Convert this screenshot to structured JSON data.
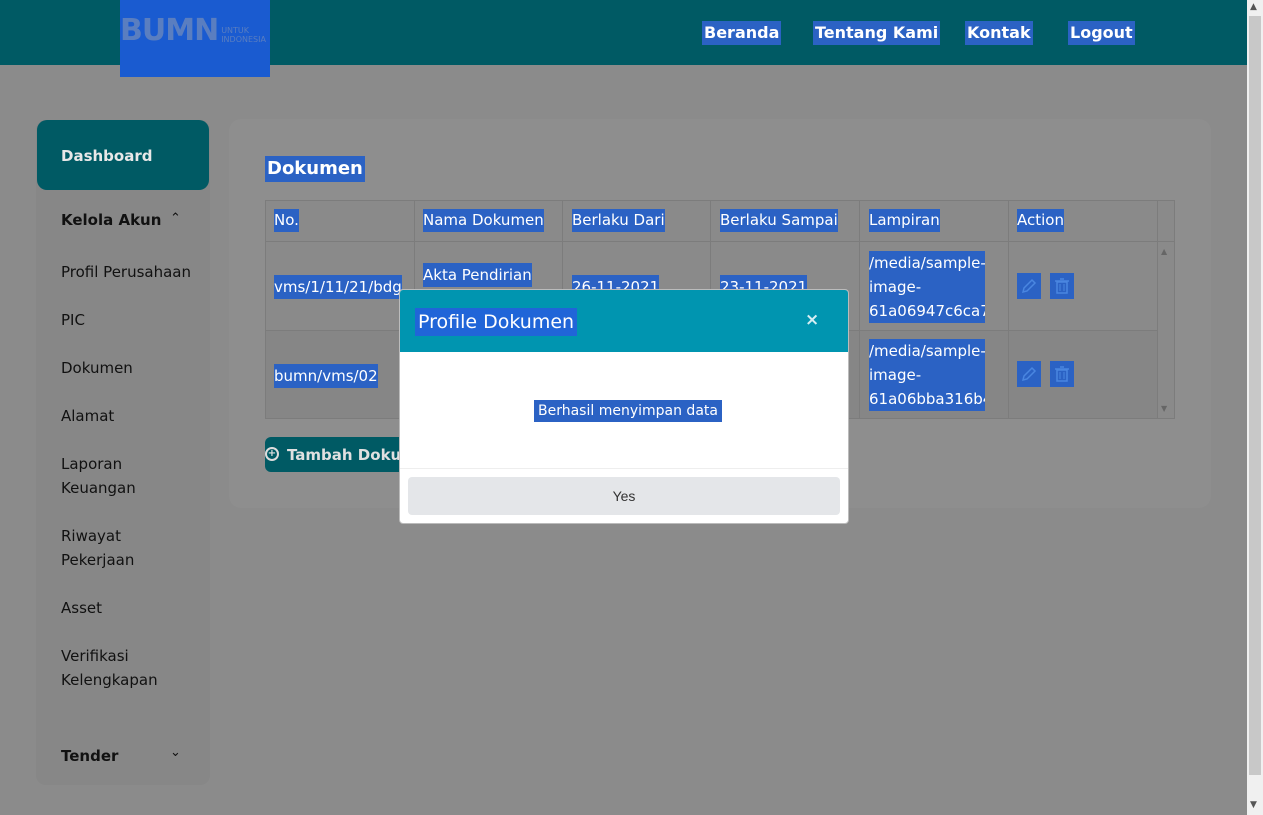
{
  "header": {
    "logo_text": "BUMN",
    "logo_subtext": "UNTUK INDONESIA",
    "nav": [
      "Beranda",
      "Tentang Kami",
      "Kontak",
      "Logout"
    ]
  },
  "sidebar": {
    "dashboard": "Dashboard",
    "kelola_akun": "Kelola Akun",
    "items": [
      "Profil Perusahaan",
      "PIC",
      "Dokumen",
      "Alamat",
      "Laporan Keuangan",
      "Riwayat Pekerjaan",
      "Asset",
      "Verifikasi Kelengkapan"
    ],
    "tender": "Tender"
  },
  "main": {
    "title": "Dokumen",
    "columns": [
      "No.",
      "Nama Dokumen",
      "Berlaku Dari",
      "Berlaku Sampai",
      "Lampiran",
      "Action"
    ],
    "rows": [
      {
        "no": "vms/1/11/21/bdg",
        "nama": "Akta Pendirian",
        "dari": "26-11-2021",
        "sampai": "23-11-2021",
        "lampiran": "/media/sample-image-61a06947c6ca70..."
      },
      {
        "no": "bumn/vms/02",
        "nama": "",
        "dari": "",
        "sampai": "",
        "lampiran": "/media/sample-image-61a06bba316b4..."
      }
    ],
    "add_button": "Tambah Dokumen"
  },
  "modal": {
    "title": "Profile Dokumen",
    "close": "×",
    "message": "Berhasil menyimpan data",
    "yes": "Yes"
  },
  "colors": {
    "teal_dark": "#005a64",
    "modal_header": "#0095b0",
    "selection": "#2b62c4"
  }
}
